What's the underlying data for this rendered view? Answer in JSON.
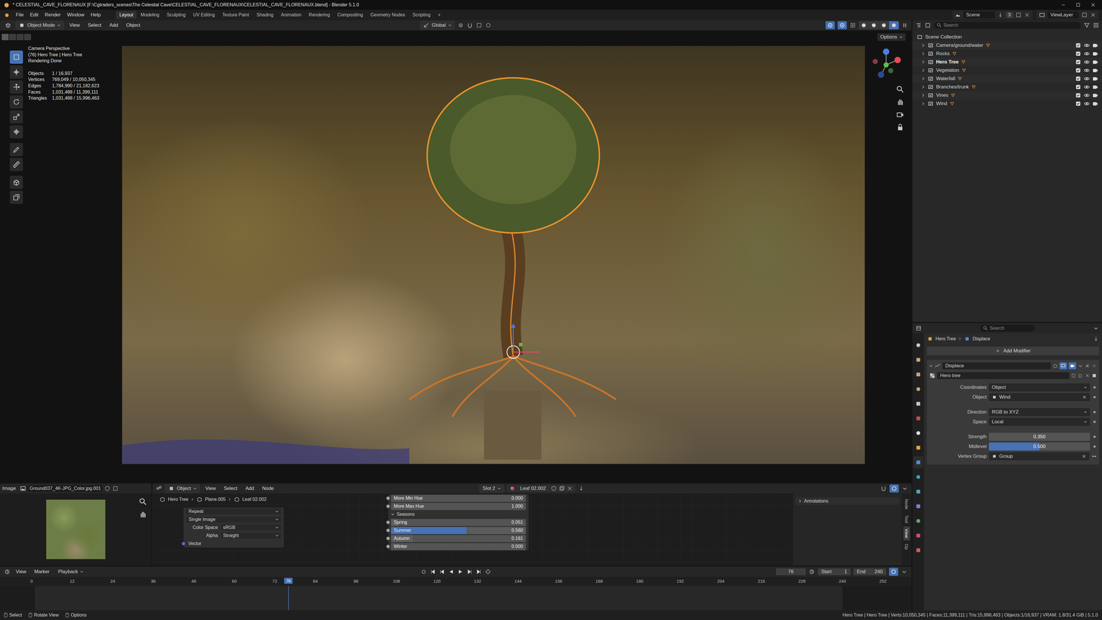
{
  "window": {
    "title": "* CELESTIAL_CAVE_FLORENAUX [F:\\Cgtraders_scenes\\The Celestial Cave\\CELESTIAL_CAVE_FLORENAUX\\CELESTIAL_CAVE_FLORENAUX.blend] - Blender 5.1.0"
  },
  "menus": [
    "File",
    "Edit",
    "Render",
    "Window",
    "Help"
  ],
  "workspaces": [
    {
      "label": "Layout",
      "selected": true
    },
    {
      "label": "Modeling",
      "selected": false
    },
    {
      "label": "Sculpting",
      "selected": false
    },
    {
      "label": "UV Editing",
      "selected": false
    },
    {
      "label": "Texture Paint",
      "selected": false
    },
    {
      "label": "Shading",
      "selected": false
    },
    {
      "label": "Animation",
      "selected": false
    },
    {
      "label": "Rendering",
      "selected": false
    },
    {
      "label": "Compositing",
      "selected": false
    },
    {
      "label": "Geometry Nodes",
      "selected": false
    },
    {
      "label": "Scripting",
      "selected": false
    }
  ],
  "add_workspace": "+",
  "scene": {
    "name": "Scene",
    "users": "3"
  },
  "view_layer": "ViewLayer",
  "viewport": {
    "mode": "Object Mode",
    "menus": [
      "View",
      "Select",
      "Add",
      "Object"
    ],
    "orientation": "Global",
    "options": "Options",
    "toggles": [
      {
        "selected": true
      },
      {
        "selected": true
      }
    ],
    "shading": [
      {
        "selected": false
      },
      {
        "selected": false
      },
      {
        "selected": false
      },
      {
        "selected": true
      }
    ],
    "tools": [
      {
        "selected": true
      },
      {
        "selected": false
      },
      {
        "selected": false
      },
      {
        "selected": false
      },
      {
        "selected": false
      },
      {
        "selected": false
      },
      {
        "selected": false
      },
      {
        "selected": false
      },
      {
        "selected": false
      },
      {
        "selected": false
      }
    ],
    "overlay": {
      "lines": [
        "Camera Perspective",
        "(76) Hero Tree | Hero Tree",
        "Rendering Done"
      ],
      "stats": [
        {
          "label": "Objects",
          "value": "1 / 16,937"
        },
        {
          "label": "Vertices",
          "value": "769,049 / 10,050,345"
        },
        {
          "label": "Edges",
          "value": "1,784,990 / 21,182,623"
        },
        {
          "label": "Faces",
          "value": "1,031,488 / 11,399,111"
        },
        {
          "label": "Triangles",
          "value": "1,031,488 / 15,996,463"
        }
      ]
    }
  },
  "outliner": {
    "search": "Search",
    "root": "Scene Collection",
    "items": [
      {
        "name": "Camera/ground/water",
        "selected": false,
        "enabled": true,
        "visible": true,
        "renderable": true
      },
      {
        "name": "Rocks",
        "selected": false,
        "enabled": true,
        "visible": true,
        "renderable": true
      },
      {
        "name": "Hero Tree",
        "selected": true,
        "enabled": true,
        "visible": true,
        "renderable": true
      },
      {
        "name": "Vegetation",
        "selected": false,
        "enabled": true,
        "visible": true,
        "renderable": true
      },
      {
        "name": "Waterfall",
        "selected": false,
        "enabled": true,
        "visible": true,
        "renderable": true
      },
      {
        "name": "Branches/trunk",
        "selected": false,
        "enabled": true,
        "visible": true,
        "renderable": true
      },
      {
        "name": "Vines",
        "selected": false,
        "enabled": true,
        "visible": true,
        "renderable": true
      },
      {
        "name": "Wind",
        "selected": false,
        "enabled": true,
        "visible": true,
        "renderable": true
      }
    ]
  },
  "properties": {
    "search": "Search",
    "tabs": [
      {
        "selected": false
      },
      {
        "selected": false
      },
      {
        "selected": false
      },
      {
        "selected": false
      },
      {
        "selected": false
      },
      {
        "selected": false
      },
      {
        "selected": false
      },
      {
        "selected": false
      },
      {
        "selected": true
      },
      {
        "selected": false
      },
      {
        "selected": false
      },
      {
        "selected": false
      },
      {
        "selected": false
      },
      {
        "selected": false
      },
      {
        "selected": false
      }
    ],
    "breadcrumb": [
      "Hero Tree",
      "Displace"
    ],
    "add_modifier": "Add Modifier",
    "modifier": {
      "name": "Displace",
      "expanded": true,
      "texture": "Hero tree",
      "fields": [
        {
          "label": "Coordinates",
          "value": "Object",
          "kind": "dropdown"
        },
        {
          "label": "Object",
          "value": "Wind",
          "kind": "object"
        },
        {
          "label": "Direction",
          "value": "RGB to XYZ",
          "kind": "dropdown"
        },
        {
          "label": "Space",
          "value": "Local",
          "kind": "dropdown"
        },
        {
          "label": "Strength",
          "value": "0.350",
          "kind": "number"
        },
        {
          "label": "Midlevel",
          "value": "0.500",
          "kind": "slider",
          "level": 0.5
        },
        {
          "label": "Vertex Group",
          "value": "Group",
          "kind": "group"
        }
      ]
    }
  },
  "image_editor": {
    "label": "Image",
    "image": "Ground037_4K-JPG_Color.jpg.001"
  },
  "node_editor": {
    "type": "Object",
    "menus": [
      "View",
      "Select",
      "Add",
      "Node"
    ],
    "slot": "Slot 2",
    "material": "Leaf 02.002",
    "overlay_on": true,
    "breadcrumb": [
      "Hero Tree",
      "Plane.005",
      "Leaf 02.002"
    ],
    "image_node": {
      "rows": [
        {
          "label": "Repeat",
          "value": "",
          "kind": "text"
        },
        {
          "label": "Single Image",
          "value": "",
          "kind": "text"
        },
        {
          "label": "Color Space",
          "value": "sRGB",
          "kind": "dropdown"
        },
        {
          "label": "Alpha",
          "value": "Straight",
          "kind": "dropdown"
        },
        {
          "label": "Vector",
          "value": "",
          "kind": "socket"
        }
      ]
    },
    "hsv_node": {
      "rows": [
        {
          "label": "More Min Hue",
          "value": "0.000"
        },
        {
          "label": "More Max Hue",
          "value": "1.000"
        }
      ],
      "section": "Seasons",
      "section_expanded": true,
      "seasons": [
        {
          "label": "Spring",
          "value": "0.051",
          "level": 0.051,
          "selected": false
        },
        {
          "label": "Summer",
          "value": "0.560",
          "level": 0.56,
          "selected": true
        },
        {
          "label": "Autumn",
          "value": "0.161",
          "level": 0.161,
          "selected": false
        },
        {
          "label": "Winter",
          "value": "0.000",
          "level": 0,
          "selected": false
        }
      ]
    },
    "sidebar": {
      "panel": "Annotations",
      "expanded": false,
      "tabs": [
        {
          "label": "Node",
          "selected": false
        },
        {
          "label": "Tool",
          "selected": false
        },
        {
          "label": "View",
          "selected": true
        },
        {
          "label": "Op",
          "selected": false
        }
      ]
    }
  },
  "timeline": {
    "menus": [
      "View",
      "Marker"
    ],
    "playback": "Playback",
    "current_frame": "76",
    "start_label": "Start",
    "start": "1",
    "end_label": "End",
    "end": "240",
    "overlay_on": true,
    "ticks": [
      "0",
      "12",
      "24",
      "36",
      "48",
      "60",
      "72",
      "84",
      "96",
      "108",
      "120",
      "132",
      "144",
      "156",
      "168",
      "180",
      "192",
      "204",
      "216",
      "228",
      "240",
      "252"
    ],
    "playhead": 76
  },
  "status_bar": {
    "hints": [
      "Select",
      "Rotate View",
      "Options"
    ],
    "info": "Hero Tree | Hero Tree | Verts:10,050,345 | Faces:11,399,111 | Tris:15,996,463 | Objects:1/16,937 | VRAM: 1.8/31.4 GiB | 5.1.0"
  }
}
